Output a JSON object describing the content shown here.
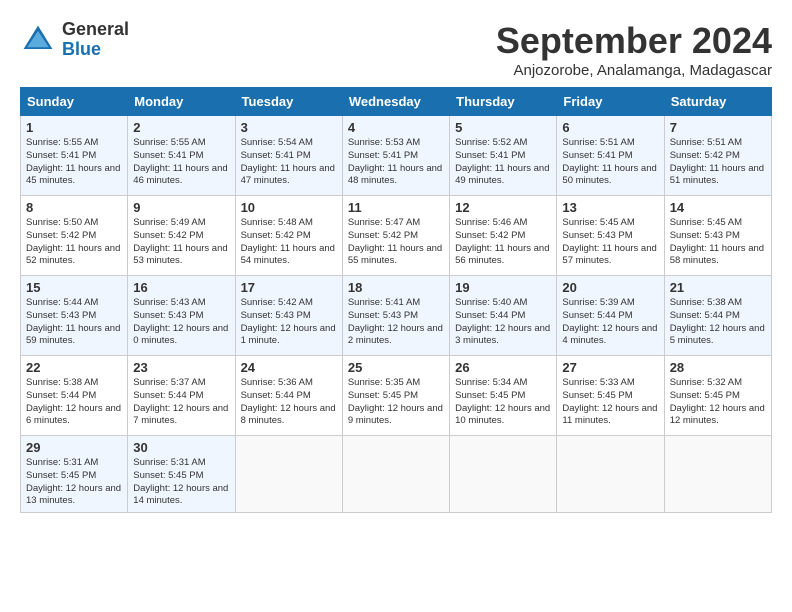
{
  "header": {
    "logo_general": "General",
    "logo_blue": "Blue",
    "month_title": "September 2024",
    "location": "Anjozorobe, Analamanga, Madagascar"
  },
  "weekdays": [
    "Sunday",
    "Monday",
    "Tuesday",
    "Wednesday",
    "Thursday",
    "Friday",
    "Saturday"
  ],
  "weeks": [
    [
      {
        "day": "1",
        "sunrise": "5:55 AM",
        "sunset": "5:41 PM",
        "daylight": "11 hours and 45 minutes."
      },
      {
        "day": "2",
        "sunrise": "5:55 AM",
        "sunset": "5:41 PM",
        "daylight": "11 hours and 46 minutes."
      },
      {
        "day": "3",
        "sunrise": "5:54 AM",
        "sunset": "5:41 PM",
        "daylight": "11 hours and 47 minutes."
      },
      {
        "day": "4",
        "sunrise": "5:53 AM",
        "sunset": "5:41 PM",
        "daylight": "11 hours and 48 minutes."
      },
      {
        "day": "5",
        "sunrise": "5:52 AM",
        "sunset": "5:41 PM",
        "daylight": "11 hours and 49 minutes."
      },
      {
        "day": "6",
        "sunrise": "5:51 AM",
        "sunset": "5:41 PM",
        "daylight": "11 hours and 50 minutes."
      },
      {
        "day": "7",
        "sunrise": "5:51 AM",
        "sunset": "5:42 PM",
        "daylight": "11 hours and 51 minutes."
      }
    ],
    [
      {
        "day": "8",
        "sunrise": "5:50 AM",
        "sunset": "5:42 PM",
        "daylight": "11 hours and 52 minutes."
      },
      {
        "day": "9",
        "sunrise": "5:49 AM",
        "sunset": "5:42 PM",
        "daylight": "11 hours and 53 minutes."
      },
      {
        "day": "10",
        "sunrise": "5:48 AM",
        "sunset": "5:42 PM",
        "daylight": "11 hours and 54 minutes."
      },
      {
        "day": "11",
        "sunrise": "5:47 AM",
        "sunset": "5:42 PM",
        "daylight": "11 hours and 55 minutes."
      },
      {
        "day": "12",
        "sunrise": "5:46 AM",
        "sunset": "5:42 PM",
        "daylight": "11 hours and 56 minutes."
      },
      {
        "day": "13",
        "sunrise": "5:45 AM",
        "sunset": "5:43 PM",
        "daylight": "11 hours and 57 minutes."
      },
      {
        "day": "14",
        "sunrise": "5:45 AM",
        "sunset": "5:43 PM",
        "daylight": "11 hours and 58 minutes."
      }
    ],
    [
      {
        "day": "15",
        "sunrise": "5:44 AM",
        "sunset": "5:43 PM",
        "daylight": "11 hours and 59 minutes."
      },
      {
        "day": "16",
        "sunrise": "5:43 AM",
        "sunset": "5:43 PM",
        "daylight": "12 hours and 0 minutes."
      },
      {
        "day": "17",
        "sunrise": "5:42 AM",
        "sunset": "5:43 PM",
        "daylight": "12 hours and 1 minute."
      },
      {
        "day": "18",
        "sunrise": "5:41 AM",
        "sunset": "5:43 PM",
        "daylight": "12 hours and 2 minutes."
      },
      {
        "day": "19",
        "sunrise": "5:40 AM",
        "sunset": "5:44 PM",
        "daylight": "12 hours and 3 minutes."
      },
      {
        "day": "20",
        "sunrise": "5:39 AM",
        "sunset": "5:44 PM",
        "daylight": "12 hours and 4 minutes."
      },
      {
        "day": "21",
        "sunrise": "5:38 AM",
        "sunset": "5:44 PM",
        "daylight": "12 hours and 5 minutes."
      }
    ],
    [
      {
        "day": "22",
        "sunrise": "5:38 AM",
        "sunset": "5:44 PM",
        "daylight": "12 hours and 6 minutes."
      },
      {
        "day": "23",
        "sunrise": "5:37 AM",
        "sunset": "5:44 PM",
        "daylight": "12 hours and 7 minutes."
      },
      {
        "day": "24",
        "sunrise": "5:36 AM",
        "sunset": "5:44 PM",
        "daylight": "12 hours and 8 minutes."
      },
      {
        "day": "25",
        "sunrise": "5:35 AM",
        "sunset": "5:45 PM",
        "daylight": "12 hours and 9 minutes."
      },
      {
        "day": "26",
        "sunrise": "5:34 AM",
        "sunset": "5:45 PM",
        "daylight": "12 hours and 10 minutes."
      },
      {
        "day": "27",
        "sunrise": "5:33 AM",
        "sunset": "5:45 PM",
        "daylight": "12 hours and 11 minutes."
      },
      {
        "day": "28",
        "sunrise": "5:32 AM",
        "sunset": "5:45 PM",
        "daylight": "12 hours and 12 minutes."
      }
    ],
    [
      {
        "day": "29",
        "sunrise": "5:31 AM",
        "sunset": "5:45 PM",
        "daylight": "12 hours and 13 minutes."
      },
      {
        "day": "30",
        "sunrise": "5:31 AM",
        "sunset": "5:45 PM",
        "daylight": "12 hours and 14 minutes."
      },
      {
        "day": "",
        "sunrise": "",
        "sunset": "",
        "daylight": ""
      },
      {
        "day": "",
        "sunrise": "",
        "sunset": "",
        "daylight": ""
      },
      {
        "day": "",
        "sunrise": "",
        "sunset": "",
        "daylight": ""
      },
      {
        "day": "",
        "sunrise": "",
        "sunset": "",
        "daylight": ""
      },
      {
        "day": "",
        "sunrise": "",
        "sunset": "",
        "daylight": ""
      }
    ]
  ]
}
